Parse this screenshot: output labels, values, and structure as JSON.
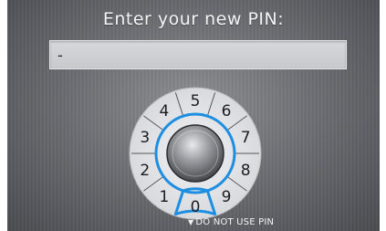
{
  "prompt": {
    "title": "Enter your new PIN:"
  },
  "pin_entry": {
    "value": "-"
  },
  "dial": {
    "digits": [
      "0",
      "1",
      "2",
      "3",
      "4",
      "5",
      "6",
      "7",
      "8",
      "9"
    ],
    "selected": "0"
  },
  "footer": {
    "hint_label": "DO NOT USE PIN"
  },
  "colors": {
    "accent_ring": "#1e8fe0",
    "background": "#6e6f74",
    "dial_face": "#e7e7ea"
  }
}
